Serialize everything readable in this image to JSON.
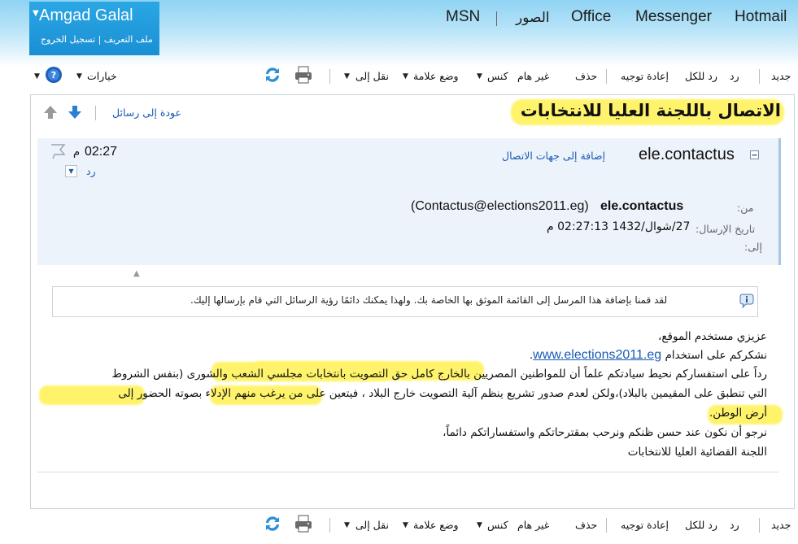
{
  "header": {
    "user_name": "Amgad Galal",
    "user_links": "ملف التعريف | تسجيل الخروج",
    "nav": [
      "Hotmail",
      "Messenger",
      "Office",
      "الصور",
      "MSN"
    ]
  },
  "toolbar": {
    "new": "جديد",
    "reply": "رد",
    "reply_all": "رد للكل",
    "forward": "إعادة توجيه",
    "delete": "حذف",
    "not_junk": "غير هام",
    "sweep": "كنس",
    "mark": "وضع علامة",
    "move_to": "نقل إلى",
    "options": "خيارات"
  },
  "nav_row": {
    "back": "عودة إلى رسائل"
  },
  "message": {
    "subject": "الاتصال باللجنة العليا للانتخابات",
    "sender_short": "ele.contactus",
    "add_contact": "إضافة إلى جهات الاتصال",
    "time": "02:27",
    "time_suffix": "م",
    "reply": "رد",
    "from_label": "من:",
    "from_name": "ele.contactus",
    "from_email": "(Contactus@elections2011.eg)",
    "date_label": "تاريخ الإرسال:",
    "date_value": "27/شوال/1432 02:27:13 م",
    "to_label": "إلى:",
    "notice": "لقد قمنا بإضافة هذا المرسل إلى القائمة الموثق بها الخاصة بك. ولهذا يمكنك دائمًا رؤية الرسائل التي قام بإرسالها إليك.",
    "body": {
      "l1": "عزيزي مستخدم الموقع،",
      "l2_text": "نشكركم على استخدام",
      "l2_link": "www.elections2011.eg",
      "l2_end": ".",
      "l3": "رداً على استفساركم نحيط سيادتكم علماً أن للمواطنين المصريين بالخارج كامل حق التصويت بانتخابات مجلسي الشعب والشورى (بنفس الشروط",
      "l4": "التي تنطبق على المقيمين بالبلاد)،ولكن لعدم صدور تشريع ينظم آلية التصويت خارج البلاد ، فيتعين على من يرغب منهم الإدلاء بصوته الحضور إلى",
      "l5": "أرض الوطن.",
      "l6": "نرجو أن نكون عند حسن ظنكم ونرحب بمقترحاتكم واستفساراتكم دائماً،",
      "l7": "اللجنة القضائية العليا للانتخابات"
    }
  },
  "colors": {
    "accent": "#1a8fd4",
    "highlight": "#fff36b",
    "link": "#1a5bb5"
  }
}
